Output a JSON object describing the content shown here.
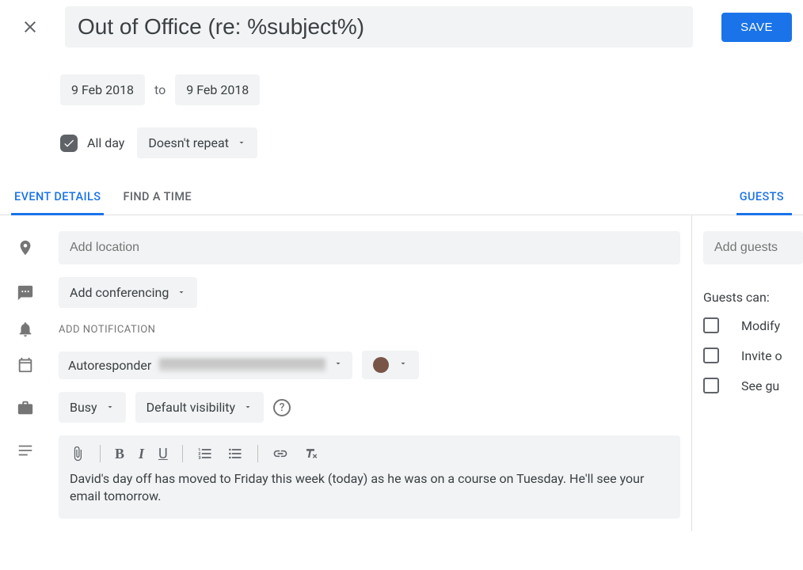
{
  "header": {
    "title_value": "Out of Office (re: %subject%)",
    "save_label": "SAVE"
  },
  "dates": {
    "start": "9 Feb 2018",
    "to_label": "to",
    "end": "9 Feb 2018"
  },
  "options": {
    "all_day_label": "All day",
    "all_day_checked": true,
    "recurrence": "Doesn't repeat"
  },
  "tabs": {
    "event_details": "EVENT DETAILS",
    "find_a_time": "FIND A TIME",
    "guests": "GUESTS"
  },
  "details": {
    "location_placeholder": "Add location",
    "conferencing_label": "Add conferencing",
    "add_notification_label": "ADD NOTIFICATION",
    "calendar_name": "Autoresponder",
    "calendar_color": "#795548",
    "availability": "Busy",
    "visibility": "Default visibility",
    "help_symbol": "?",
    "description": "David's day off has moved to Friday this week (today) as he was on a course on Tuesday. He'll see your email tomorrow."
  },
  "toolbar_icons": {
    "attach": "attach-icon",
    "bold": "B",
    "italic": "I",
    "underline": "U",
    "numbered_list": "numbered-list-icon",
    "bulleted_list": "bulleted-list-icon",
    "link": "link-icon",
    "clear_format": "clear-format-icon"
  },
  "guests": {
    "add_placeholder": "Add guests",
    "permissions_title": "Guests can:",
    "perms": [
      {
        "label": "Modify"
      },
      {
        "label": "Invite o"
      },
      {
        "label": "See gu"
      }
    ]
  }
}
